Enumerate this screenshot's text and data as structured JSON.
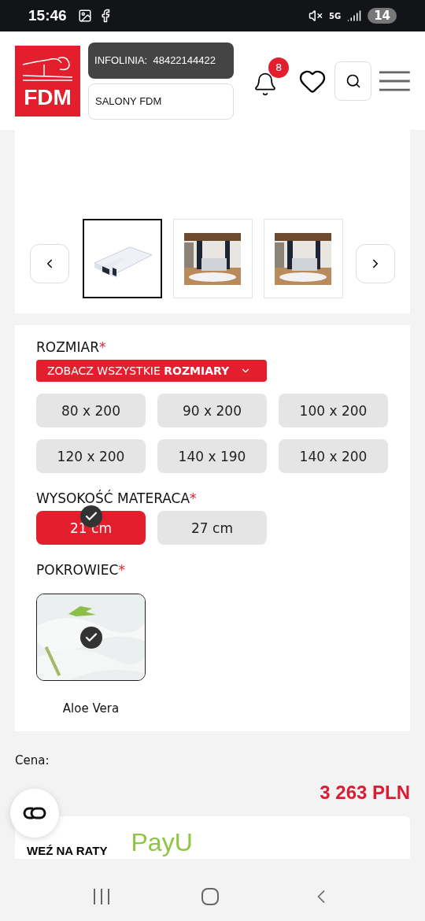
{
  "status_bar": {
    "time": "15:46",
    "network": "5G",
    "battery": "14"
  },
  "header": {
    "logo": "FDM",
    "infoline_label": "INFOLINIA:",
    "infoline_number": "48422144422",
    "stores": "SALONY FDM",
    "notifications": "8"
  },
  "gallery": {
    "thumbnails": [
      {
        "kind": "mattress",
        "selected": true
      },
      {
        "kind": "bedroom",
        "selected": false
      },
      {
        "kind": "bedroom",
        "selected": false
      }
    ]
  },
  "size": {
    "label": "ROZMIAR",
    "required": "*",
    "dropdown": "ZOBACZ WSZYSTKIE **ROZMIARY**",
    "choices": [
      {
        "label": "80 x 200",
        "selected": false
      },
      {
        "label": "90 x 200",
        "selected": false
      },
      {
        "label": "100 x 200",
        "selected": false
      },
      {
        "label": "120 x 200",
        "selected": false
      },
      {
        "label": "140 x 190",
        "selected": false
      },
      {
        "label": "140 x 200",
        "selected": false
      }
    ]
  },
  "height": {
    "label": "WYSOKOŚĆ MATERACA",
    "required": "*",
    "choices": [
      {
        "label": "21 cm",
        "selected": true
      },
      {
        "label": "27 cm",
        "selected": false
      }
    ]
  },
  "cover": {
    "label": "POKROWIEC",
    "required": "*",
    "choices": [
      {
        "label": "Aloe Vera",
        "selected": true
      }
    ]
  },
  "price": {
    "label": "Cena:",
    "value": "3 263 PLN"
  },
  "installments": {
    "title": "WEŹ NA RATY",
    "logo": "PayU"
  }
}
